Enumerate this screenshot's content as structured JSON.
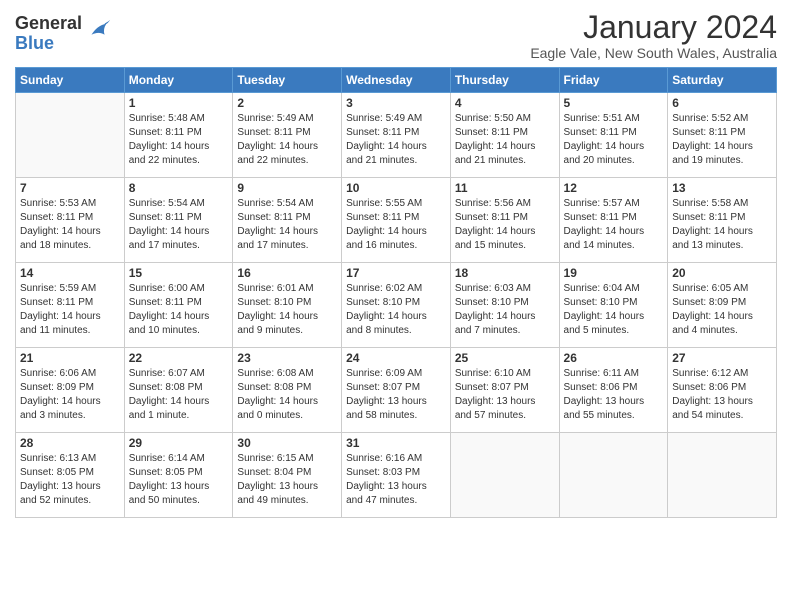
{
  "logo": {
    "general": "General",
    "blue": "Blue"
  },
  "header": {
    "month": "January 2024",
    "location": "Eagle Vale, New South Wales, Australia"
  },
  "days_of_week": [
    "Sunday",
    "Monday",
    "Tuesday",
    "Wednesday",
    "Thursday",
    "Friday",
    "Saturday"
  ],
  "weeks": [
    [
      {
        "day": "",
        "info": ""
      },
      {
        "day": "1",
        "info": "Sunrise: 5:48 AM\nSunset: 8:11 PM\nDaylight: 14 hours\nand 22 minutes."
      },
      {
        "day": "2",
        "info": "Sunrise: 5:49 AM\nSunset: 8:11 PM\nDaylight: 14 hours\nand 22 minutes."
      },
      {
        "day": "3",
        "info": "Sunrise: 5:49 AM\nSunset: 8:11 PM\nDaylight: 14 hours\nand 21 minutes."
      },
      {
        "day": "4",
        "info": "Sunrise: 5:50 AM\nSunset: 8:11 PM\nDaylight: 14 hours\nand 21 minutes."
      },
      {
        "day": "5",
        "info": "Sunrise: 5:51 AM\nSunset: 8:11 PM\nDaylight: 14 hours\nand 20 minutes."
      },
      {
        "day": "6",
        "info": "Sunrise: 5:52 AM\nSunset: 8:11 PM\nDaylight: 14 hours\nand 19 minutes."
      }
    ],
    [
      {
        "day": "7",
        "info": "Sunrise: 5:53 AM\nSunset: 8:11 PM\nDaylight: 14 hours\nand 18 minutes."
      },
      {
        "day": "8",
        "info": "Sunrise: 5:54 AM\nSunset: 8:11 PM\nDaylight: 14 hours\nand 17 minutes."
      },
      {
        "day": "9",
        "info": "Sunrise: 5:54 AM\nSunset: 8:11 PM\nDaylight: 14 hours\nand 17 minutes."
      },
      {
        "day": "10",
        "info": "Sunrise: 5:55 AM\nSunset: 8:11 PM\nDaylight: 14 hours\nand 16 minutes."
      },
      {
        "day": "11",
        "info": "Sunrise: 5:56 AM\nSunset: 8:11 PM\nDaylight: 14 hours\nand 15 minutes."
      },
      {
        "day": "12",
        "info": "Sunrise: 5:57 AM\nSunset: 8:11 PM\nDaylight: 14 hours\nand 14 minutes."
      },
      {
        "day": "13",
        "info": "Sunrise: 5:58 AM\nSunset: 8:11 PM\nDaylight: 14 hours\nand 13 minutes."
      }
    ],
    [
      {
        "day": "14",
        "info": "Sunrise: 5:59 AM\nSunset: 8:11 PM\nDaylight: 14 hours\nand 11 minutes."
      },
      {
        "day": "15",
        "info": "Sunrise: 6:00 AM\nSunset: 8:11 PM\nDaylight: 14 hours\nand 10 minutes."
      },
      {
        "day": "16",
        "info": "Sunrise: 6:01 AM\nSunset: 8:10 PM\nDaylight: 14 hours\nand 9 minutes."
      },
      {
        "day": "17",
        "info": "Sunrise: 6:02 AM\nSunset: 8:10 PM\nDaylight: 14 hours\nand 8 minutes."
      },
      {
        "day": "18",
        "info": "Sunrise: 6:03 AM\nSunset: 8:10 PM\nDaylight: 14 hours\nand 7 minutes."
      },
      {
        "day": "19",
        "info": "Sunrise: 6:04 AM\nSunset: 8:10 PM\nDaylight: 14 hours\nand 5 minutes."
      },
      {
        "day": "20",
        "info": "Sunrise: 6:05 AM\nSunset: 8:09 PM\nDaylight: 14 hours\nand 4 minutes."
      }
    ],
    [
      {
        "day": "21",
        "info": "Sunrise: 6:06 AM\nSunset: 8:09 PM\nDaylight: 14 hours\nand 3 minutes."
      },
      {
        "day": "22",
        "info": "Sunrise: 6:07 AM\nSunset: 8:08 PM\nDaylight: 14 hours\nand 1 minute."
      },
      {
        "day": "23",
        "info": "Sunrise: 6:08 AM\nSunset: 8:08 PM\nDaylight: 14 hours\nand 0 minutes."
      },
      {
        "day": "24",
        "info": "Sunrise: 6:09 AM\nSunset: 8:07 PM\nDaylight: 13 hours\nand 58 minutes."
      },
      {
        "day": "25",
        "info": "Sunrise: 6:10 AM\nSunset: 8:07 PM\nDaylight: 13 hours\nand 57 minutes."
      },
      {
        "day": "26",
        "info": "Sunrise: 6:11 AM\nSunset: 8:06 PM\nDaylight: 13 hours\nand 55 minutes."
      },
      {
        "day": "27",
        "info": "Sunrise: 6:12 AM\nSunset: 8:06 PM\nDaylight: 13 hours\nand 54 minutes."
      }
    ],
    [
      {
        "day": "28",
        "info": "Sunrise: 6:13 AM\nSunset: 8:05 PM\nDaylight: 13 hours\nand 52 minutes."
      },
      {
        "day": "29",
        "info": "Sunrise: 6:14 AM\nSunset: 8:05 PM\nDaylight: 13 hours\nand 50 minutes."
      },
      {
        "day": "30",
        "info": "Sunrise: 6:15 AM\nSunset: 8:04 PM\nDaylight: 13 hours\nand 49 minutes."
      },
      {
        "day": "31",
        "info": "Sunrise: 6:16 AM\nSunset: 8:03 PM\nDaylight: 13 hours\nand 47 minutes."
      },
      {
        "day": "",
        "info": ""
      },
      {
        "day": "",
        "info": ""
      },
      {
        "day": "",
        "info": ""
      }
    ]
  ]
}
